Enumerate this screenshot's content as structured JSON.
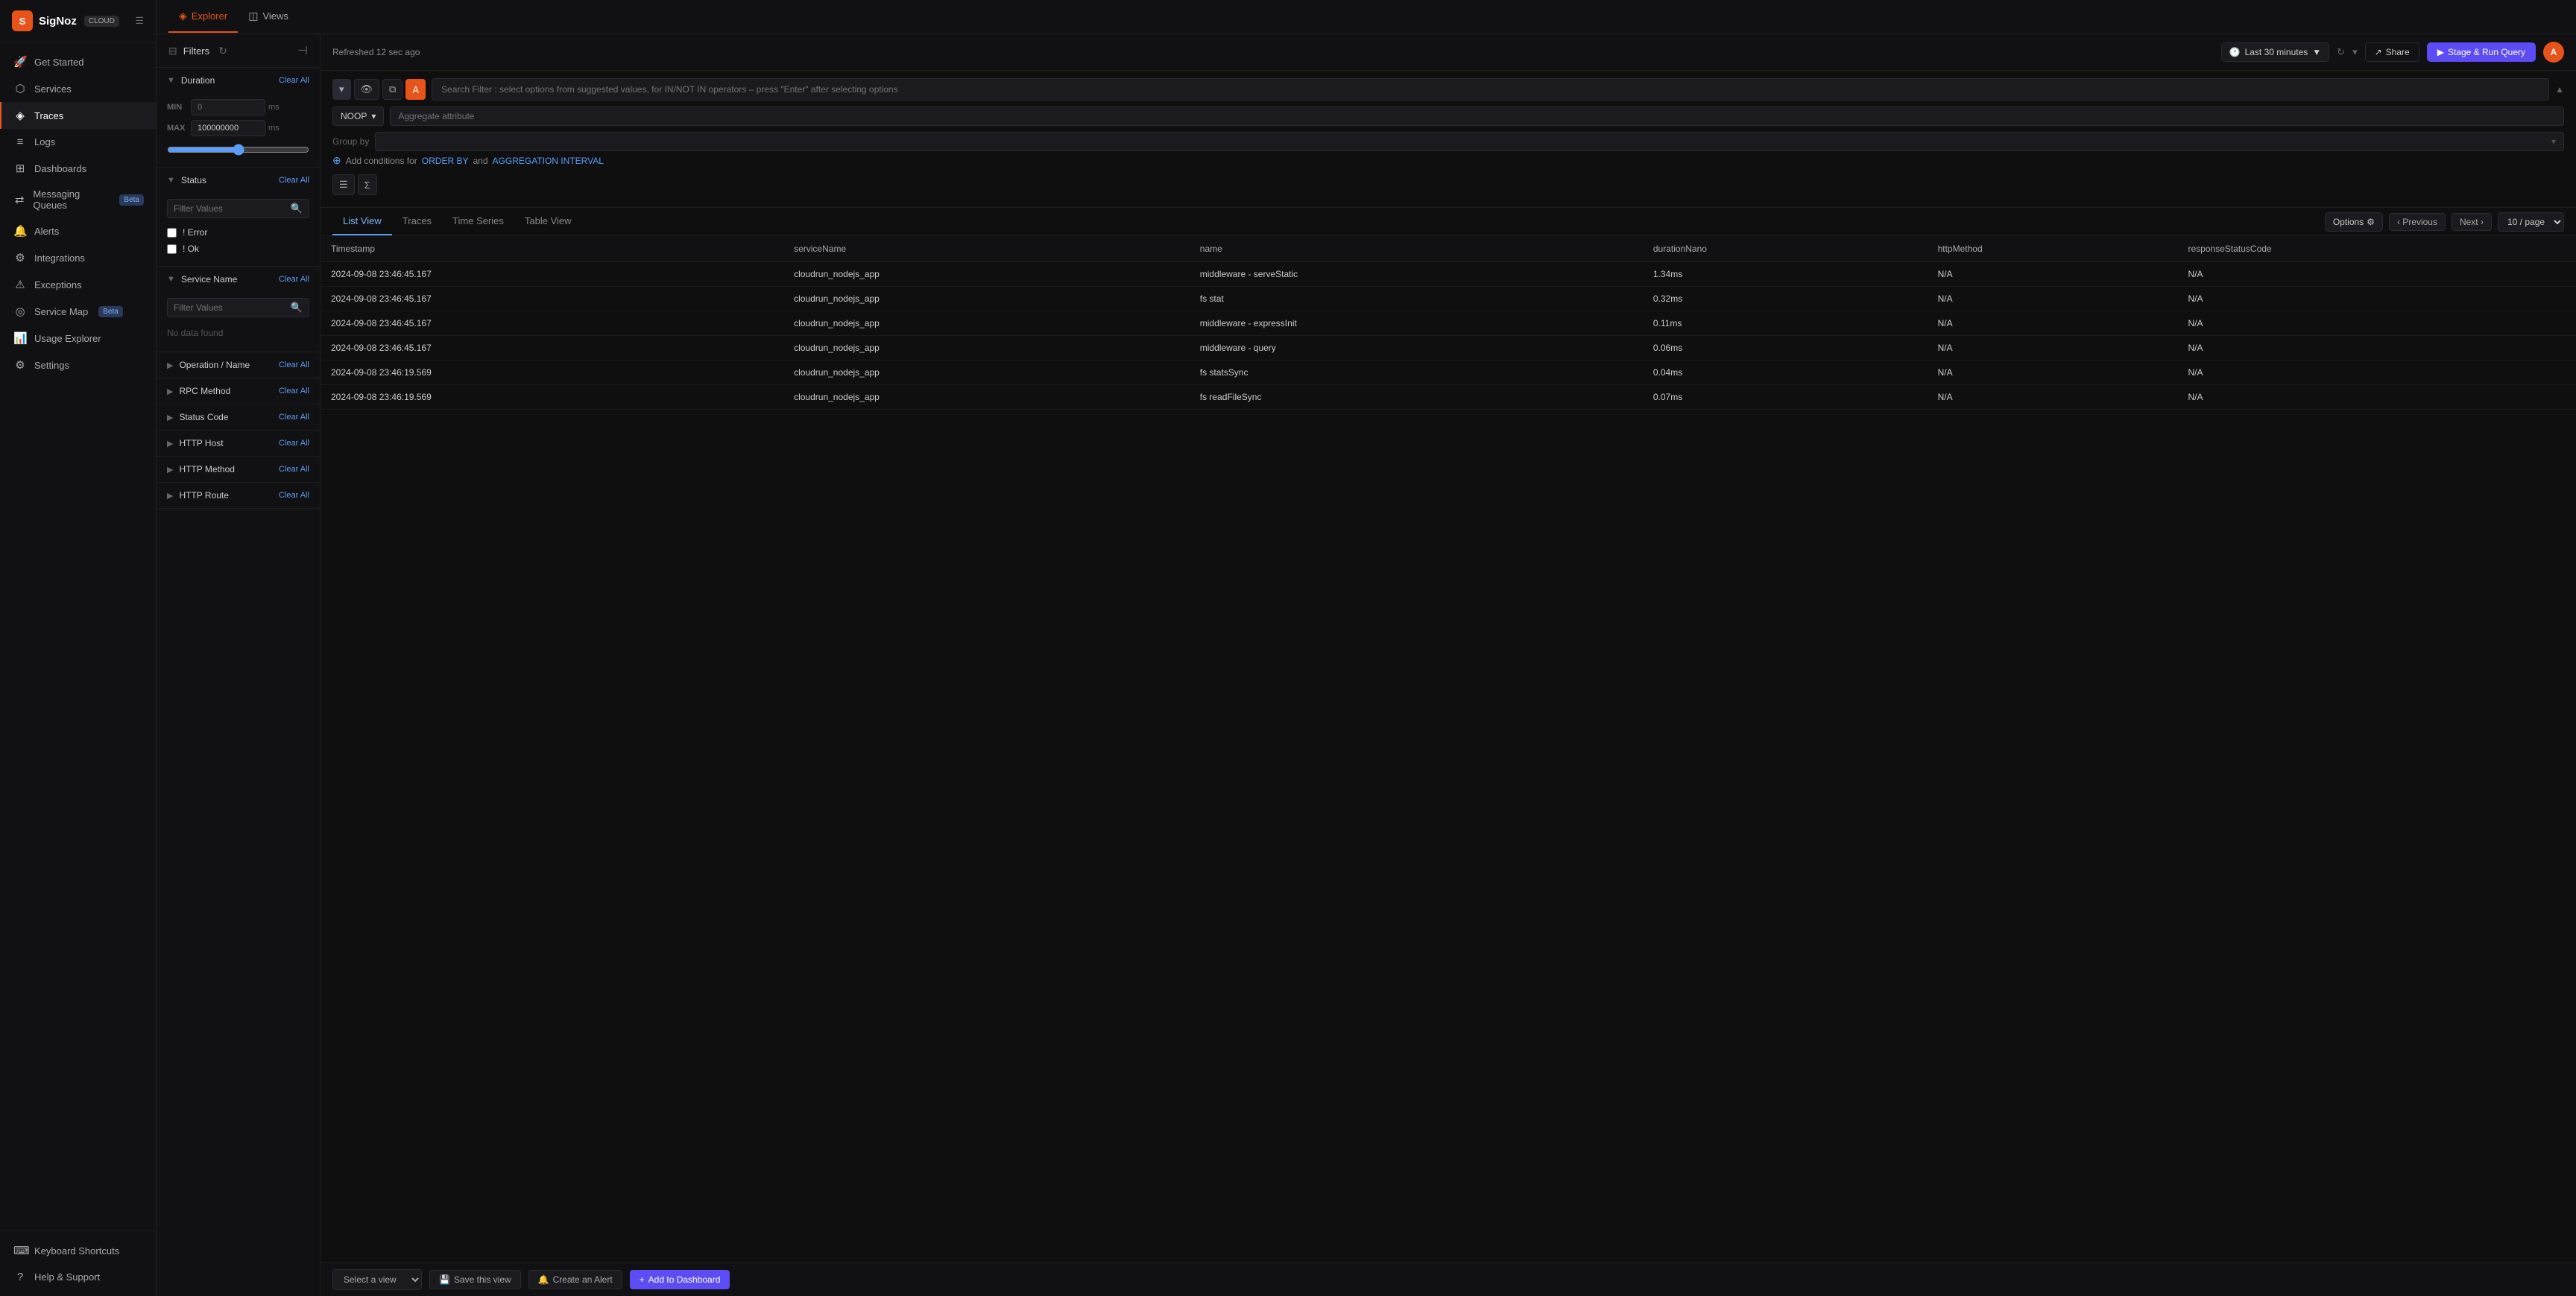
{
  "app": {
    "name": "SigNoz",
    "badge": "CLOUD",
    "user_initial": "A"
  },
  "sidebar": {
    "items": [
      {
        "id": "get-started",
        "label": "Get Started",
        "icon": "🚀"
      },
      {
        "id": "services",
        "label": "Services",
        "icon": "⬡",
        "active": false
      },
      {
        "id": "traces",
        "label": "Traces",
        "icon": "◈",
        "active": true
      },
      {
        "id": "logs",
        "label": "Logs",
        "icon": "≡"
      },
      {
        "id": "dashboards",
        "label": "Dashboards",
        "icon": "⊞"
      },
      {
        "id": "messaging-queues",
        "label": "Messaging Queues",
        "icon": "⇄",
        "badge": "Beta"
      },
      {
        "id": "alerts",
        "label": "Alerts",
        "icon": "🔔"
      },
      {
        "id": "integrations",
        "label": "Integrations",
        "icon": "⚙"
      },
      {
        "id": "exceptions",
        "label": "Exceptions",
        "icon": "⚠"
      },
      {
        "id": "service-map",
        "label": "Service Map",
        "icon": "◎",
        "badge": "Beta"
      },
      {
        "id": "usage-explorer",
        "label": "Usage Explorer",
        "icon": "📊"
      },
      {
        "id": "settings",
        "label": "Settings",
        "icon": "⚙"
      }
    ],
    "bottom_items": [
      {
        "id": "keyboard-shortcuts",
        "label": "Keyboard Shortcuts",
        "icon": "⌨"
      },
      {
        "id": "help-support",
        "label": "Help & Support",
        "icon": "?"
      }
    ]
  },
  "top_tabs": [
    {
      "id": "explorer",
      "label": "Explorer",
      "icon": "◈",
      "active": true
    },
    {
      "id": "views",
      "label": "Views",
      "icon": "◫"
    }
  ],
  "filters": {
    "title": "Filters",
    "sections": [
      {
        "id": "duration",
        "title": "Duration",
        "clear_label": "Clear All",
        "expanded": true,
        "min_label": "MIN",
        "max_label": "MAX",
        "min_value": "0",
        "max_value": "100000000",
        "min_placeholder": "0",
        "max_placeholder": "100000000",
        "unit": "ms"
      },
      {
        "id": "status",
        "title": "Status",
        "clear_label": "Clear All",
        "expanded": true,
        "filter_placeholder": "Filter Values",
        "options": [
          {
            "id": "error",
            "label": "! Error",
            "checked": false
          },
          {
            "id": "ok",
            "label": "! Ok",
            "checked": false
          }
        ]
      },
      {
        "id": "service-name",
        "title": "Service Name",
        "clear_label": "Clear All",
        "expanded": true,
        "filter_placeholder": "Filter Values",
        "no_data": "No data found"
      },
      {
        "id": "operation-name",
        "title": "Operation / Name",
        "clear_label": "Clear All",
        "expanded": false
      },
      {
        "id": "rpc-method",
        "title": "RPC Method",
        "clear_label": "Clear All",
        "expanded": false
      },
      {
        "id": "status-code",
        "title": "Status Code",
        "clear_label": "Clear All",
        "expanded": false
      },
      {
        "id": "http-host",
        "title": "HTTP Host",
        "clear_label": "Clear All",
        "expanded": false
      },
      {
        "id": "http-method",
        "title": "HTTP Method",
        "clear_label": "Clear All",
        "expanded": false
      },
      {
        "id": "http-route",
        "title": "HTTP Route",
        "clear_label": "Clear All",
        "expanded": false
      }
    ]
  },
  "toolbar": {
    "refresh_info": "Refreshed 12 sec ago",
    "time_label": "Last 30 minutes",
    "share_label": "Share",
    "stage_run_label": "Stage & Run Query"
  },
  "query_builder": {
    "search_placeholder": "Search Filter : select options from suggested values, for IN/NOT IN operators – press \"Enter\" after selecting options",
    "aggregate_label": "NOOP",
    "aggregate_placeholder": "Aggregate attribute",
    "group_by_label": "Group by",
    "group_by_placeholder": "",
    "add_conditions_prefix": "Add conditions for",
    "order_by_label": "ORDER BY",
    "aggregation_label": "AGGREGATION INTERVAL"
  },
  "view_tabs": [
    {
      "id": "list-view",
      "label": "List View",
      "active": true
    },
    {
      "id": "traces",
      "label": "Traces",
      "active": false
    },
    {
      "id": "time-series",
      "label": "Time Series",
      "active": false
    },
    {
      "id": "table-view",
      "label": "Table View",
      "active": false
    }
  ],
  "pagination": {
    "options_label": "Options",
    "previous_label": "Previous",
    "next_label": "Next",
    "page_size": "10 / page"
  },
  "table": {
    "columns": [
      {
        "id": "timestamp",
        "label": "Timestamp"
      },
      {
        "id": "serviceName",
        "label": "serviceName"
      },
      {
        "id": "name",
        "label": "name"
      },
      {
        "id": "durationNano",
        "label": "durationNano"
      },
      {
        "id": "httpMethod",
        "label": "httpMethod"
      },
      {
        "id": "responseStatusCode",
        "label": "responseStatusCode"
      }
    ],
    "rows": [
      {
        "timestamp": "2024-09-08 23:46:45.167",
        "serviceName": "cloudrun_nodejs_app",
        "name": "middleware - serveStatic",
        "durationNano": "1.34ms",
        "httpMethod": "N/A",
        "responseStatusCode": "N/A"
      },
      {
        "timestamp": "2024-09-08 23:46:45.167",
        "serviceName": "cloudrun_nodejs_app",
        "name": "fs stat",
        "durationNano": "0.32ms",
        "httpMethod": "N/A",
        "responseStatusCode": "N/A"
      },
      {
        "timestamp": "2024-09-08 23:46:45.167",
        "serviceName": "cloudrun_nodejs_app",
        "name": "middleware - expressInit",
        "durationNano": "0.11ms",
        "httpMethod": "N/A",
        "responseStatusCode": "N/A"
      },
      {
        "timestamp": "2024-09-08 23:46:45.167",
        "serviceName": "cloudrun_nodejs_app",
        "name": "middleware - query",
        "durationNano": "0.06ms",
        "httpMethod": "N/A",
        "responseStatusCode": "N/A"
      },
      {
        "timestamp": "2024-09-08 23:46:19.569",
        "serviceName": "cloudrun_nodejs_app",
        "name": "fs statsSync",
        "durationNano": "0.04ms",
        "httpMethod": "N/A",
        "responseStatusCode": "N/A"
      },
      {
        "timestamp": "2024-09-08 23:46:19.569",
        "serviceName": "cloudrun_nodejs_app",
        "name": "fs readFileSync",
        "durationNano": "0.07ms",
        "httpMethod": "N/A",
        "responseStatusCode": "N/A"
      }
    ]
  },
  "bottom_bar": {
    "select_view_placeholder": "Select a view",
    "save_view_label": "Save this view",
    "create_alert_label": "Create an Alert",
    "add_dashboard_label": "Add to Dashboard"
  }
}
